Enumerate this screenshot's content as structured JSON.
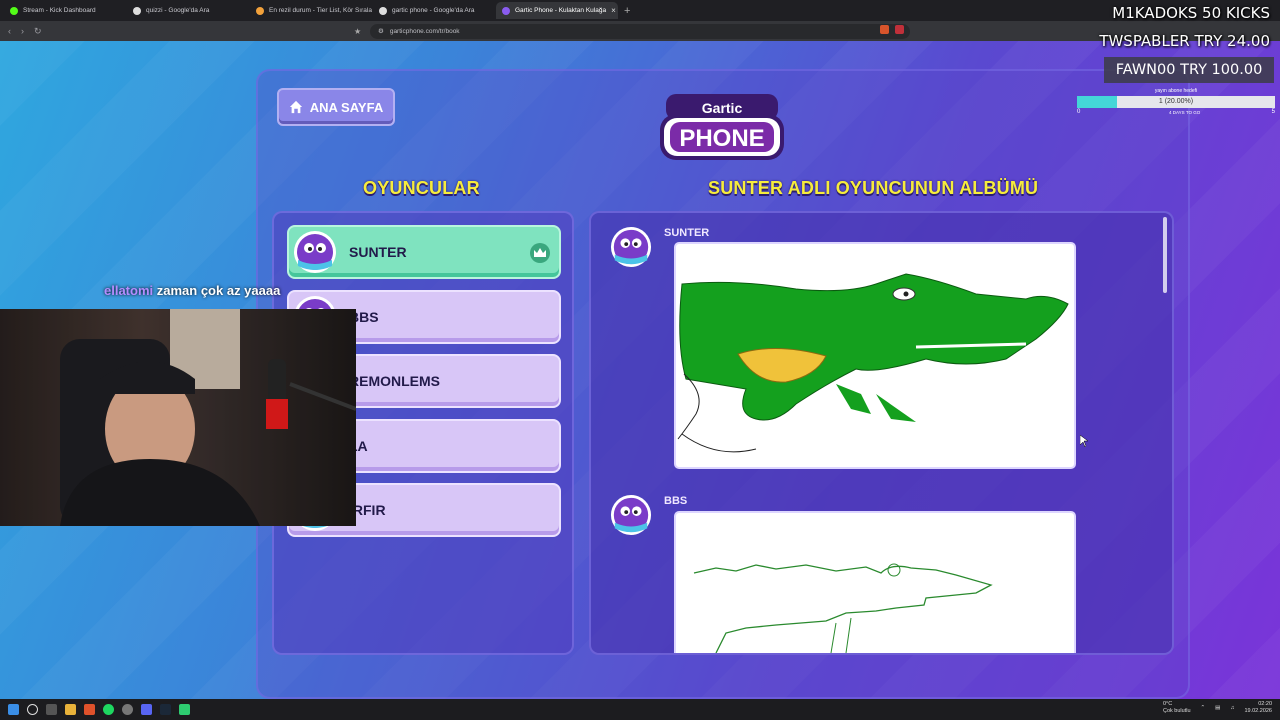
{
  "browser": {
    "tabs": [
      {
        "title": "Stream - Kick Dashboard",
        "favicon_color": "#53fc18",
        "active": false
      },
      {
        "title": "quizzi - Google'da Ara",
        "favicon_color": "#dddddd",
        "active": false
      },
      {
        "title": "En rezil durum - Tier List, Kör Sıralam",
        "favicon_color": "#f2a13b",
        "active": false
      },
      {
        "title": "gartic phone - Google'da Ara",
        "favicon_color": "#dddddd",
        "active": false
      },
      {
        "title": "Gartic Phone - Kulaktan Kulağa",
        "favicon_color": "#8a5cf0",
        "active": true
      }
    ],
    "url": "garticphone.com/tr/book"
  },
  "game": {
    "home_button": "ANA SAYFA",
    "logo_top": "Gartic",
    "logo_bottom": "PHONE",
    "players_title": "OYUNCULAR",
    "album_title": "SUNTER ADLI OYUNCUNUN ALBÜMÜ",
    "players": [
      {
        "name": "SUNTER",
        "active": true,
        "host": true
      },
      {
        "name": "BBS",
        "active": false,
        "host": false
      },
      {
        "name": "REMONLEMS",
        "active": false,
        "host": false
      },
      {
        "name": "LA",
        "active": false,
        "host": false
      },
      {
        "name": "IRFIR",
        "active": false,
        "host": false
      }
    ],
    "album": [
      {
        "author": "SUNTER",
        "drawing": "crocodile-color-drawing"
      },
      {
        "author": "BBS",
        "drawing": "crocodile-line-drawing"
      }
    ]
  },
  "overlay": {
    "line1": "M1KADOKS  50 KICKS",
    "line2": "TWSPABLER  TRY 24.00",
    "line3": "FAWN00  TRY 100.00",
    "goal": {
      "label": "yayın abone hedefi",
      "value_text": "1 (20.00%)",
      "fraction": 0.2,
      "min": "0",
      "max": "5",
      "sub": "4 DAYS TO GO"
    },
    "chat": {
      "user": "ellatomi",
      "message": "zaman çok az yaaaa"
    }
  },
  "taskbar": {
    "weather_temp": "0°C",
    "weather_desc": "Çok bulutlu",
    "time": "02:20",
    "date": "19.02.2026"
  }
}
